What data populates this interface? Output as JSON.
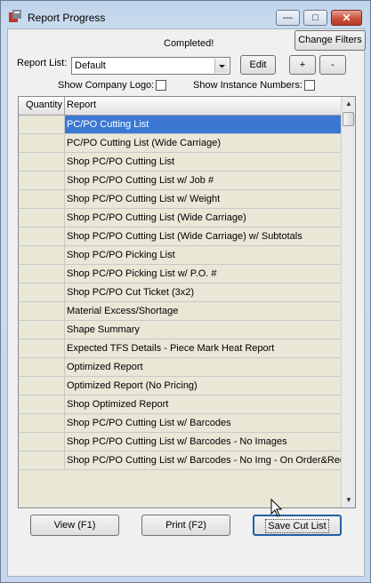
{
  "window": {
    "title": "Report Progress",
    "minimize_label": "—",
    "maximize_label": "□",
    "close_label": "✕"
  },
  "status": "Completed!",
  "toolbar": {
    "change_filters": "Change Filters",
    "report_list_label": "Report List:",
    "report_list_value": "Default",
    "edit": "Edit",
    "plus": "+",
    "minus": "-"
  },
  "options": {
    "show_company_logo": "Show Company Logo:",
    "show_instance_numbers": "Show Instance Numbers:"
  },
  "grid": {
    "headers": [
      "Quantity",
      "Report"
    ],
    "rows": [
      {
        "quantity": "",
        "report": "PC/PO Cutting List",
        "selected": true
      },
      {
        "quantity": "",
        "report": "PC/PO Cutting List (Wide Carriage)"
      },
      {
        "quantity": "",
        "report": "Shop PC/PO Cutting List"
      },
      {
        "quantity": "",
        "report": "Shop PC/PO Cutting List w/ Job #"
      },
      {
        "quantity": "",
        "report": "Shop PC/PO Cutting List w/ Weight"
      },
      {
        "quantity": "",
        "report": "Shop PC/PO Cutting List (Wide Carriage)"
      },
      {
        "quantity": "",
        "report": "Shop PC/PO Cutting List (Wide Carriage) w/ Subtotals"
      },
      {
        "quantity": "",
        "report": "Shop PC/PO Picking List"
      },
      {
        "quantity": "",
        "report": "Shop PC/PO Picking List w/ P.O. #"
      },
      {
        "quantity": "",
        "report": "Shop PC/PO Cut Ticket (3x2)"
      },
      {
        "quantity": "",
        "report": "Material Excess/Shortage"
      },
      {
        "quantity": "",
        "report": "Shape Summary"
      },
      {
        "quantity": "",
        "report": "Expected TFS Details - Piece Mark Heat Report"
      },
      {
        "quantity": "",
        "report": "Optimized Report"
      },
      {
        "quantity": "",
        "report": "Optimized Report (No Pricing)"
      },
      {
        "quantity": "",
        "report": "Shop Optimized Report"
      },
      {
        "quantity": "",
        "report": "Shop PC/PO Cutting List w/ Barcodes"
      },
      {
        "quantity": "",
        "report": "Shop PC/PO Cutting List w/ Barcodes - No Images"
      },
      {
        "quantity": "",
        "report": "Shop PC/PO Cutting List w/ Barcodes - No Img - On Order&Req"
      }
    ]
  },
  "buttons": {
    "view": "View (F1)",
    "print": "Print (F2)",
    "save_cut_list": "Save Cut List"
  },
  "colors": {
    "selection": "#3a78d4",
    "grid_background": "#e9e7d6",
    "close_button": "#c8503b"
  }
}
